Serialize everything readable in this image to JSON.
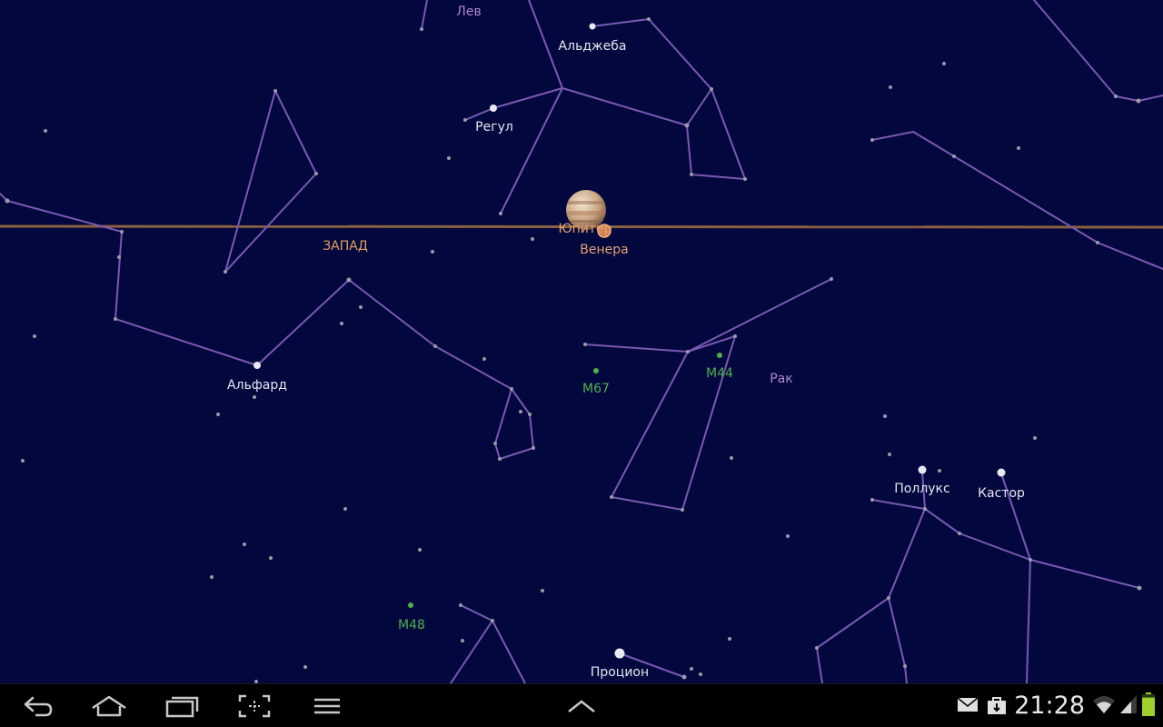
{
  "sky": {
    "direction_label": "ЗАПАД",
    "stars": [
      {
        "name": "Альджеба"
      },
      {
        "name": "Регул"
      },
      {
        "name": "Альфард"
      },
      {
        "name": "Поллукс"
      },
      {
        "name": "Кастор"
      },
      {
        "name": "Процион"
      }
    ],
    "planets": [
      {
        "name": "Юпитер"
      },
      {
        "name": "Венера"
      }
    ],
    "constellations": [
      {
        "name": "Лев"
      },
      {
        "name": "Рак"
      }
    ],
    "messier_objects": [
      {
        "name": "M67"
      },
      {
        "name": "M44"
      },
      {
        "name": "M48"
      }
    ],
    "colors": {
      "sky_background": "#02083d",
      "constellation_line": "#7a58b4",
      "horizon_line": "#8a6040",
      "messier_green": "#4fb04f"
    }
  },
  "navbar": {
    "buttons": [
      {
        "icon": "back-icon"
      },
      {
        "icon": "home-icon"
      },
      {
        "icon": "recent-apps-icon"
      },
      {
        "icon": "screenshot-icon"
      },
      {
        "icon": "menu-icon"
      },
      {
        "icon": "chevron-up-icon"
      }
    ],
    "status": {
      "time": "21:28",
      "icons": [
        "email-icon",
        "store-icon",
        "wifi-icon",
        "signal-icon",
        "battery-icon"
      ],
      "battery_level": 0.85
    }
  }
}
